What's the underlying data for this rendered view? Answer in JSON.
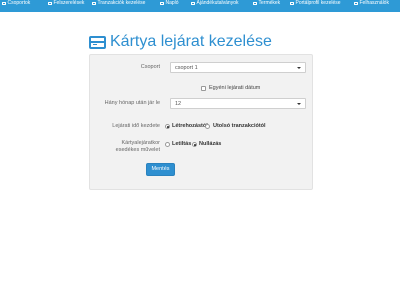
{
  "nav": {
    "items": [
      {
        "label": "Csoportok",
        "icon": "users-icon"
      },
      {
        "label": "Felszerelések",
        "icon": "gear-icon"
      },
      {
        "label": "Tranzakciók kezelése",
        "icon": "transactions-icon"
      },
      {
        "label": "Napló",
        "icon": "log-icon"
      },
      {
        "label": "Ajándékutalványok",
        "icon": "gift-icon"
      },
      {
        "label": "Termékek",
        "icon": "products-icon"
      },
      {
        "label": "Portálprofil kezelése",
        "icon": "portal-icon"
      },
      {
        "label": "Felhasználók",
        "icon": "user-icon"
      }
    ]
  },
  "page": {
    "title": "Kártya lejárat kezelése"
  },
  "form": {
    "group_label": "Csoport",
    "group_value": "csoport 1",
    "custom_date_label": "Egyéni lejárati dátum",
    "months_label": "Hány hónap után jár le",
    "months_value": "12",
    "start_label": "Lejárati idő kezdete",
    "start_option_1": "Létrehozástól",
    "start_option_2": "Utolsó tranzakciótól",
    "action_label_line1": "Kártyalejáratkor",
    "action_label_line2": "esedékes művelet",
    "action_option_1": "Letiltás",
    "action_option_2": "Nullázás",
    "save_label": "Mentés"
  },
  "colors": {
    "accent": "#2e8fd0",
    "nav_background": "#2e9ad6",
    "panel_background": "#f2f2f2"
  }
}
